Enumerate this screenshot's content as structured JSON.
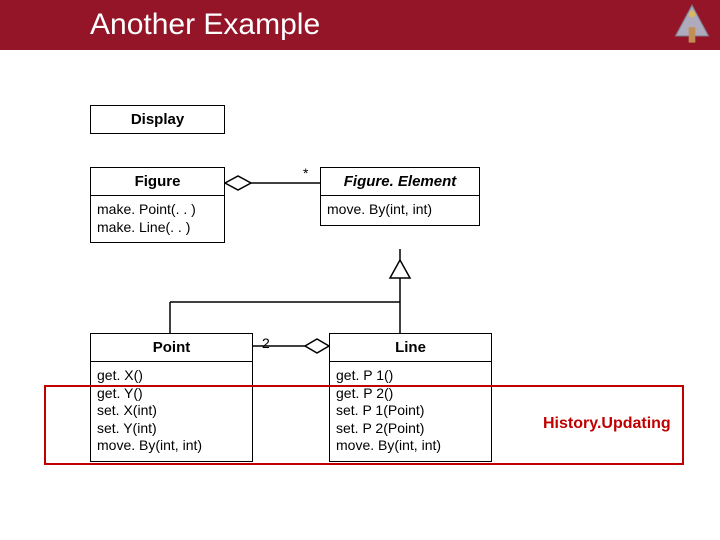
{
  "slide": {
    "title": "Another Example"
  },
  "classes": {
    "display": {
      "name": "Display"
    },
    "figure": {
      "name": "Figure",
      "ops": "make. Point(. . )\nmake. Line(. . )"
    },
    "figel": {
      "name": "Figure. Element",
      "ops": "move. By(int, int)"
    },
    "point": {
      "name": "Point",
      "ops": "get. X()\nget. Y()\nset. X(int)\nset. Y(int)\nmove. By(int, int)"
    },
    "line": {
      "name": "Line",
      "ops": "get. P 1()\nget. P 2()\nset. P 1(Point)\nset. P 2(Point)\nmove. By(int, int)"
    }
  },
  "labels": {
    "star": "*",
    "two": "2"
  },
  "aspect": {
    "name": "History.Updating"
  }
}
